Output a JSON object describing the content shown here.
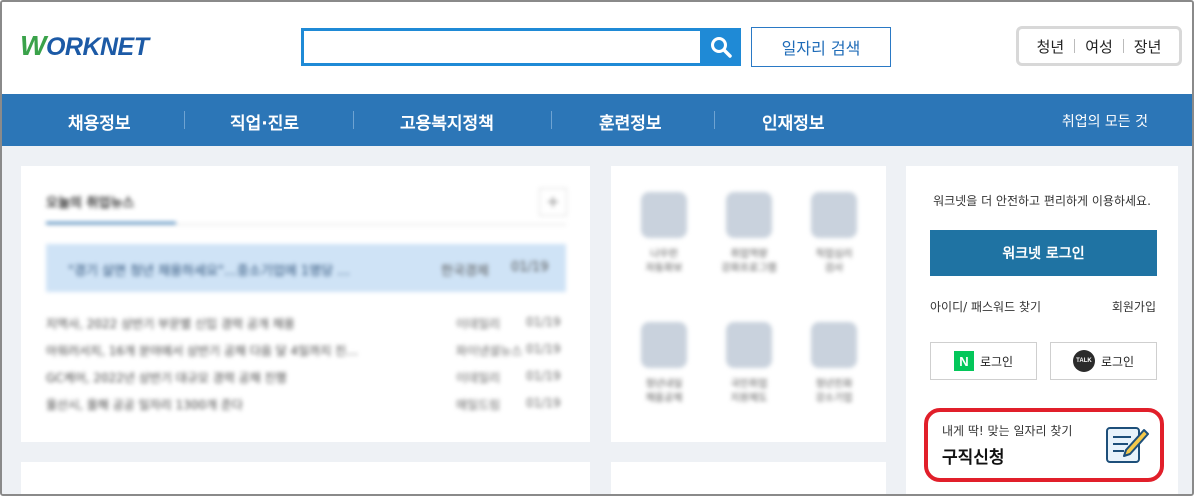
{
  "header": {
    "logo_text": "ORKNET",
    "logo_w": "W",
    "search_placeholder": "",
    "job_search_label": "일자리 검색",
    "audience": [
      "청년",
      "여성",
      "장년"
    ]
  },
  "nav": {
    "items": [
      "채용정보",
      "직업·진로",
      "고용복지정책",
      "훈련정보",
      "인재정보"
    ],
    "right_link": "취업의 모든 것"
  },
  "news": {
    "tab_label": "오늘의 취업뉴스",
    "plus": "+",
    "headline": {
      "title": "\"경기 살면 청년 채용하세요\"…중소기업에 1명당 …",
      "source": "한국경제",
      "date": "01/19"
    },
    "rows": [
      {
        "title": "지역사, 2022 상반기 부문별 신입 경력 공개 채용",
        "source": "이데일리",
        "date": "01/19"
      },
      {
        "title": "아워러서치, 16개 분야에서 상반기 공채 다음 달 4일까지 진…",
        "source": "파이낸셜뉴스",
        "date": "01/19"
      },
      {
        "title": "GC케어, 2022년 상반기 대규모 경력 공채 진행",
        "source": "이데일리",
        "date": "01/19"
      },
      {
        "title": "울산시, 올해 공공 일자리 1300개 준다",
        "source": "매일드림",
        "date": "01/19"
      }
    ]
  },
  "services": [
    {
      "label": "나우런\n자동화보",
      "icon": "gear-doc-icon"
    },
    {
      "label": "취업역량\n강화프로그램",
      "icon": "hand-coin-icon"
    },
    {
      "label": "직업심리\n검사",
      "icon": "heart-hand-icon"
    },
    {
      "label": "청년내일\n채움공제",
      "icon": "piggy-bank-icon"
    },
    {
      "label": "국민취업\n지원제도",
      "icon": "thumbs-up-icon"
    },
    {
      "label": "청년친화\n강소기업",
      "icon": "building-icon"
    }
  ],
  "login": {
    "message": "워크넷을 더 안전하고 편리하게 이용하세요.",
    "login_label": "워크넷 로그인",
    "find_label": "아이디/ 패스워드 찾기",
    "join_label": "회원가입",
    "naver_label": "로그인",
    "naver_icon_text": "N",
    "kakao_label": "로그인",
    "kakao_icon_text": "TALK"
  },
  "apply_card": {
    "subtitle": "내게 딱! 맞는 일자리 찾기",
    "title": "구직신청"
  },
  "colors": {
    "nav_bg": "#2c76b7",
    "search_blue": "#1f8ad6",
    "login_btn": "#1f73a3",
    "highlight_red": "#e11f2a",
    "naver_green": "#03c75a"
  }
}
